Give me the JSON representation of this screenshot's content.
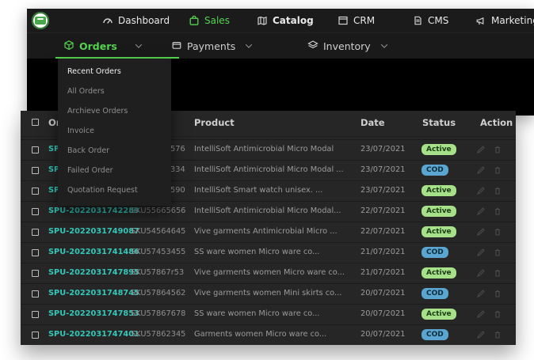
{
  "brand": {
    "logo_icon": "leaf-cart-logo-icon"
  },
  "top_nav": {
    "items": [
      {
        "label": "Dashboard",
        "icon": "gauge-icon"
      },
      {
        "label": "Sales",
        "icon": "shopping-bag-icon",
        "active": true
      },
      {
        "label": "Catalog",
        "icon": "map-icon"
      },
      {
        "label": "CRM",
        "icon": "window-icon"
      },
      {
        "label": "CMS",
        "icon": "document-icon"
      },
      {
        "label": "Marketing",
        "icon": "megaphone-icon"
      }
    ]
  },
  "sub_nav": {
    "items": [
      {
        "label": "Orders",
        "icon": "box-icon",
        "active": true
      },
      {
        "label": "Payments",
        "icon": "wallet-icon"
      },
      {
        "label": "Inventory",
        "icon": "layers-icon"
      }
    ]
  },
  "orders_menu": {
    "items": [
      {
        "label": "Recent Orders"
      },
      {
        "label": "All Orders"
      },
      {
        "label": "Archieve Orders"
      },
      {
        "label": "Invoice"
      },
      {
        "label": "Back Order"
      },
      {
        "label": "Failed Order"
      },
      {
        "label": "Quotation Request"
      }
    ]
  },
  "table": {
    "columns": {
      "order": "Or",
      "product": "Product",
      "date": "Date",
      "status": "Status",
      "action": "Action"
    },
    "rows": [
      {
        "order_id": "SP",
        "sku": "576",
        "product": "IntelliSoft Antimicrobial Micro Modal",
        "date": "23/07/2021",
        "status": "Active"
      },
      {
        "order_id": "SP",
        "sku": "334",
        "product": "IntelliSoft Antimicrobial Micro Modal ...",
        "date": "23/07/2021",
        "status": "COD"
      },
      {
        "order_id": "SP",
        "sku": "590",
        "product": "IntelliSoft Smart watch unisex. ...",
        "date": "23/07/2021",
        "status": "Active"
      },
      {
        "order_id": "SPU-2022031742289",
        "sku": "SKU55665656",
        "product": "IntelliSoft Antimicrobial Micro Modal...",
        "date": "22/07/2021",
        "status": "Active"
      },
      {
        "order_id": "SPU-2022031749087",
        "sku": "SKU54564645",
        "product": "Vive garments Antimicrobial Micro ...",
        "date": "22/07/2021",
        "status": "Active"
      },
      {
        "order_id": "SPU-2022031741486",
        "sku": "SKU57453455",
        "product": "SS ware women Micro ware co...",
        "date": "21/07/2021",
        "status": "COD"
      },
      {
        "order_id": "SPU-2022031747895",
        "sku": "SKU57867r53",
        "product": "Vive garments women Micro ware co...",
        "date": "21/07/2021",
        "status": "Active"
      },
      {
        "order_id": "SPU-2022031748745",
        "sku": "SKU57864562",
        "product": "Vive garments women Mini skirts co...",
        "date": "20/07/2021",
        "status": "COD"
      },
      {
        "order_id": "SPU-2022031747853",
        "sku": "SKU57867678",
        "product": "SS ware women Micro ware co...",
        "date": "20/07/2021",
        "status": "Active"
      },
      {
        "order_id": "SPU-2022031747401",
        "sku": "SKU57862345",
        "product": "Garments women Micro ware co...",
        "date": "20/07/2021",
        "status": "COD"
      }
    ]
  },
  "colors": {
    "accent_green": "#54d44f",
    "order_id_teal": "#35c7b9",
    "status_active": "#a6e089",
    "status_cod": "#5aa6d0"
  }
}
